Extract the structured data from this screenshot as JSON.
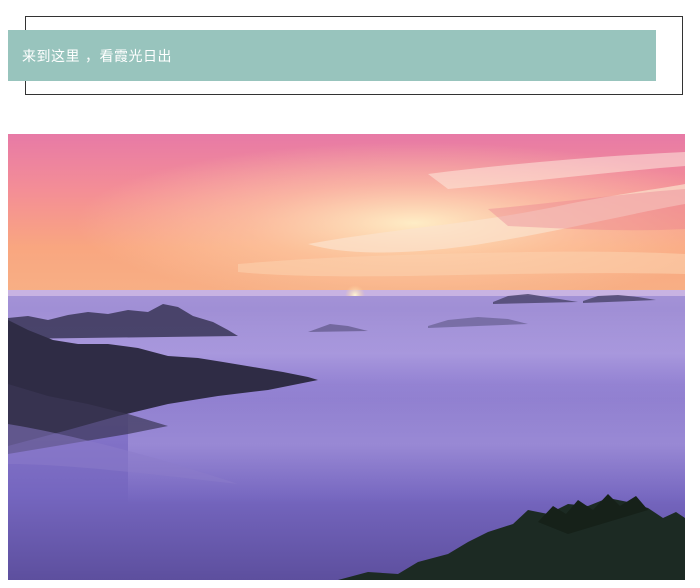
{
  "header": {
    "title": "来到这里 ，看霞光日出",
    "band_color": "#98c4bd"
  },
  "photo": {
    "subject": "sunrise-over-sea-of-clouds-photo"
  }
}
